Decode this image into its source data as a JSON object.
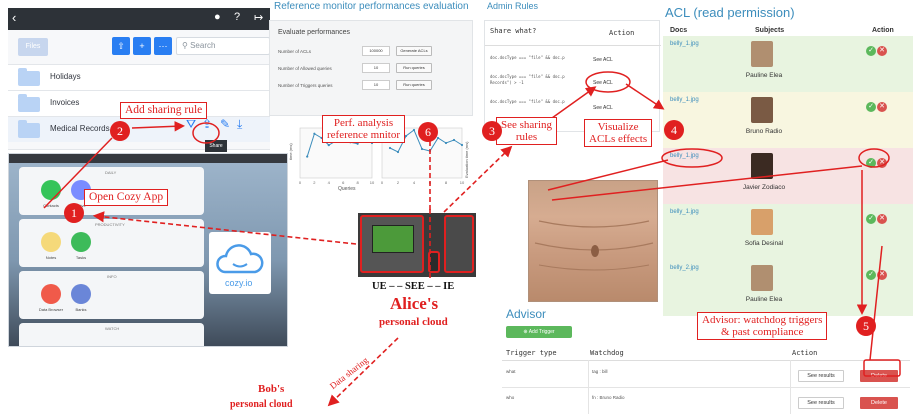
{
  "cozy_files": {
    "files_label": "Files",
    "search_placeholder": "Search",
    "folders": [
      "Holidays",
      "Invoices",
      "Medical Records"
    ],
    "tooltip": "Share"
  },
  "cozy_home": {
    "sections": [
      "DAILY",
      "PRODUCTIVITY",
      "INFO",
      "WATCH"
    ],
    "apps": [
      "Contacts",
      "Drive",
      "Notes",
      "Tasks",
      "Data Browser",
      "Banks"
    ],
    "logo_text": "cozy.io"
  },
  "ref_monitor": {
    "title": "Reference monitor performances evaluation",
    "panel_title": "Evaluate performances",
    "rows": [
      {
        "label": "Number of ACLs",
        "value": "100000",
        "button": "Generate ACLs"
      },
      {
        "label": "Number of Allowed queries",
        "value": "10",
        "button": "Run queries"
      },
      {
        "label": "Number of Triggers queries",
        "value": "10",
        "button": "Run queries"
      }
    ],
    "chart1_ylabel": "time (ms)",
    "chart2_ylabel": "Evaluation time (ms)",
    "xlabel": "Queries"
  },
  "chart_data": [
    {
      "type": "line",
      "title": "",
      "xlabel": "Queries",
      "ylabel": "time (ms)",
      "x": [
        1,
        2,
        3,
        4,
        5,
        6,
        7,
        8,
        9,
        10
      ],
      "y": [
        150,
        310,
        280,
        230,
        260,
        270,
        250,
        240,
        300,
        245
      ],
      "xlim": [
        0,
        10
      ],
      "ylim": [
        0,
        350
      ],
      "xticks": [
        "0",
        "2",
        "4",
        "6",
        "8",
        "10"
      ]
    },
    {
      "type": "line",
      "title": "",
      "xlabel": "Queries",
      "ylabel": "Evaluation time (ms)",
      "x": [
        1,
        2,
        3,
        4,
        5,
        6,
        7,
        8,
        9,
        10
      ],
      "y": [
        300,
        260,
        420,
        480,
        290,
        270,
        400,
        350,
        380,
        330
      ],
      "xlim": [
        0,
        10
      ],
      "ylim": [
        0,
        500
      ],
      "xticks": [
        "0",
        "2",
        "4",
        "6",
        "8",
        "10"
      ]
    }
  ],
  "admin_rules": {
    "title": "Admin Rules",
    "col_share": "Share what?",
    "col_action": "Action",
    "rows": [
      {
        "rule": "doc.docType === \"file\" && doc.p",
        "button": "See ACL"
      },
      {
        "rule": "doc.docType === \"file\" && doc.p Records\") > -1",
        "button": "See ACL"
      },
      {
        "rule": "doc.docType === \"file\" && doc.p",
        "button": "See ACL"
      }
    ]
  },
  "acl": {
    "title": "ACL (read permission)",
    "col_docs": "Docs",
    "col_subjects": "Subjects",
    "col_action": "Action",
    "rows": [
      {
        "doc": "belly_1.jpg",
        "subject": "Pauline Elea",
        "color": "#e8f4e0"
      },
      {
        "doc": "belly_1.jpg",
        "subject": "Bruno Radio",
        "color": "#f8f6e0"
      },
      {
        "doc": "belly_1.jpg",
        "subject": "Javier Zodiaco",
        "color": "#f7e3e3"
      },
      {
        "doc": "belly_1.jpg",
        "subject": "Sofia Desinal",
        "color": "#e8f4e0"
      },
      {
        "doc": "belly_2.jpg",
        "subject": "Pauline Elea",
        "color": "#e8f4e0"
      }
    ]
  },
  "advisor": {
    "title": "Advisor",
    "add_button": "Add Trigger",
    "col_type": "Trigger type",
    "col_watchdog": "Watchdog",
    "col_action": "Action",
    "rows": [
      {
        "type": "what",
        "watchdog": "tag : bill",
        "see": "See results",
        "del": "Delete"
      },
      {
        "type": "who",
        "watchdog": "fn : Bruno Radio",
        "see": "See results",
        "del": "Delete"
      }
    ]
  },
  "callouts": {
    "c1": {
      "num": "1",
      "text": "Open Cozy App"
    },
    "c2": {
      "num": "2",
      "text": "Add sharing rule"
    },
    "c3": {
      "num": "3",
      "line1": "See sharing",
      "line2": "rules"
    },
    "c4": {
      "num": "4",
      "line1": "Visualize",
      "line2": "ACLs effects"
    },
    "c5": {
      "num": "5",
      "line1": "Advisor: watchdog triggers",
      "line2": "& past compliance"
    },
    "c6": {
      "num": "6",
      "line1": "Perf. analysis",
      "line2": "reference mnitor"
    }
  },
  "labels": {
    "devices": "UE – – SEE – – IE",
    "alice_name": "Alice's",
    "alice_sub": "personal cloud",
    "bob_name": "Bob's",
    "bob_sub": "personal cloud",
    "data_sharing": "Data sharing"
  },
  "colors": {
    "accent": "#e02020",
    "link": "#3c8dbc",
    "cozy_blue": "#297ef2"
  }
}
